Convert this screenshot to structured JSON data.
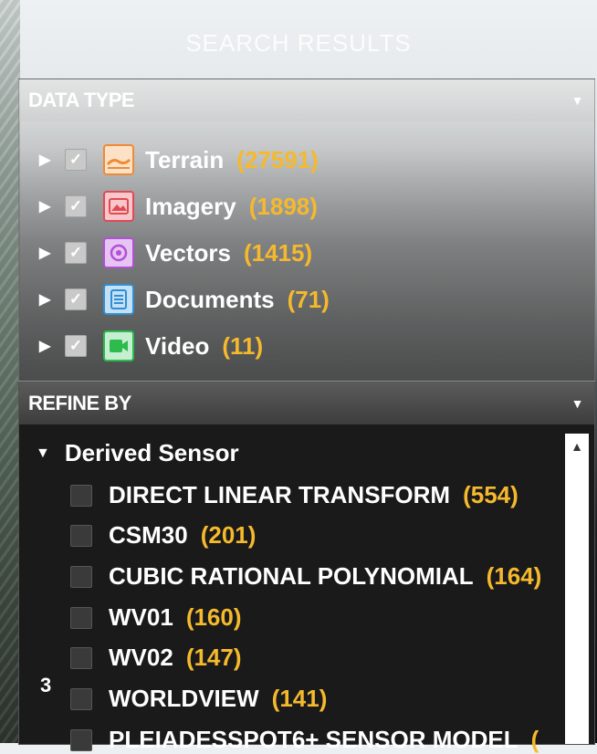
{
  "title": "SEARCH RESULTS",
  "data_type": {
    "header": "DATA TYPE",
    "items": [
      {
        "label": "Terrain",
        "count": "(27591)",
        "icon": "terrain-icon",
        "color": "#f08a35"
      },
      {
        "label": "Imagery",
        "count": "(1898)",
        "icon": "imagery-icon",
        "color": "#e04a55"
      },
      {
        "label": "Vectors",
        "count": "(1415)",
        "icon": "vectors-icon",
        "color": "#b44fd6"
      },
      {
        "label": "Documents",
        "count": "(71)",
        "icon": "documents-icon",
        "color": "#2f8fd2"
      },
      {
        "label": "Video",
        "count": "(11)",
        "icon": "video-icon",
        "color": "#2cbb4c"
      }
    ]
  },
  "refine_by": {
    "header": "REFINE BY",
    "section": "Derived Sensor",
    "items": [
      {
        "label": "DIRECT LINEAR TRANSFORM",
        "count": "(554)"
      },
      {
        "label": "CSM30",
        "count": "(201)"
      },
      {
        "label": "CUBIC RATIONAL POLYNOMIAL",
        "count": "(164)"
      },
      {
        "label": "WV01",
        "count": "(160)"
      },
      {
        "label": "WV02",
        "count": "(147)"
      },
      {
        "label": "WORLDVIEW",
        "count": "(141)"
      },
      {
        "label": "PLEIADESSPOT6+ SENSOR MODEL",
        "count": "("
      }
    ]
  },
  "corner_number": "3",
  "colors": {
    "accent_count": "#f5b92d"
  }
}
